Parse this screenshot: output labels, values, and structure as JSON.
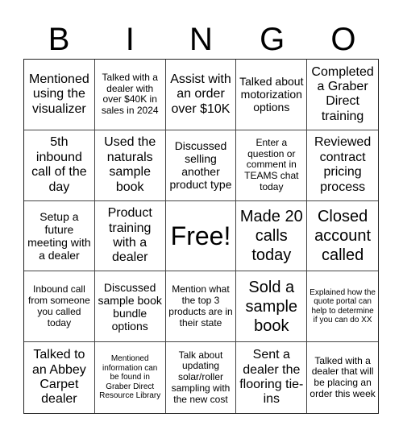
{
  "title_letters": [
    "B",
    "I",
    "N",
    "G",
    "O"
  ],
  "cells": [
    {
      "text": "Mentioned using the visualizer",
      "size": "l"
    },
    {
      "text": "Talked with a dealer with over $40K in sales in 2024",
      "size": "s"
    },
    {
      "text": "Assist with an order over $10K",
      "size": "l"
    },
    {
      "text": "Talked about motorization options",
      "size": "m"
    },
    {
      "text": "Completed a Graber Direct training",
      "size": "l"
    },
    {
      "text": "5th inbound call of the day",
      "size": "l"
    },
    {
      "text": "Used the naturals sample book",
      "size": "l"
    },
    {
      "text": "Discussed selling another product type",
      "size": "m"
    },
    {
      "text": "Enter a question or comment in TEAMS chat today",
      "size": "s"
    },
    {
      "text": "Reviewed contract pricing process",
      "size": "l"
    },
    {
      "text": "Setup a future meeting with a dealer",
      "size": "m"
    },
    {
      "text": "Product training with a dealer",
      "size": "l"
    },
    {
      "text": "Free!",
      "size": "free"
    },
    {
      "text": "Made 20 calls today",
      "size": "xl"
    },
    {
      "text": "Closed account called",
      "size": "xl"
    },
    {
      "text": "Inbound call from someone you called today",
      "size": "s"
    },
    {
      "text": "Discussed sample book bundle options",
      "size": "m"
    },
    {
      "text": "Mention what the top 3 products are in their state",
      "size": "s"
    },
    {
      "text": "Sold a sample book",
      "size": "xl"
    },
    {
      "text": "Explained how the quote portal can help to determine if you can do XX",
      "size": "xs"
    },
    {
      "text": "Talked to an Abbey Carpet dealer",
      "size": "l"
    },
    {
      "text": "Mentioned information can be found in Graber Direct Resource Library",
      "size": "xs"
    },
    {
      "text": "Talk about updating solar/roller sampling with the new cost",
      "size": "s"
    },
    {
      "text": "Sent a dealer the flooring tie-ins",
      "size": "l"
    },
    {
      "text": "Talked with a dealer that will be placing an order this week",
      "size": "s"
    }
  ]
}
